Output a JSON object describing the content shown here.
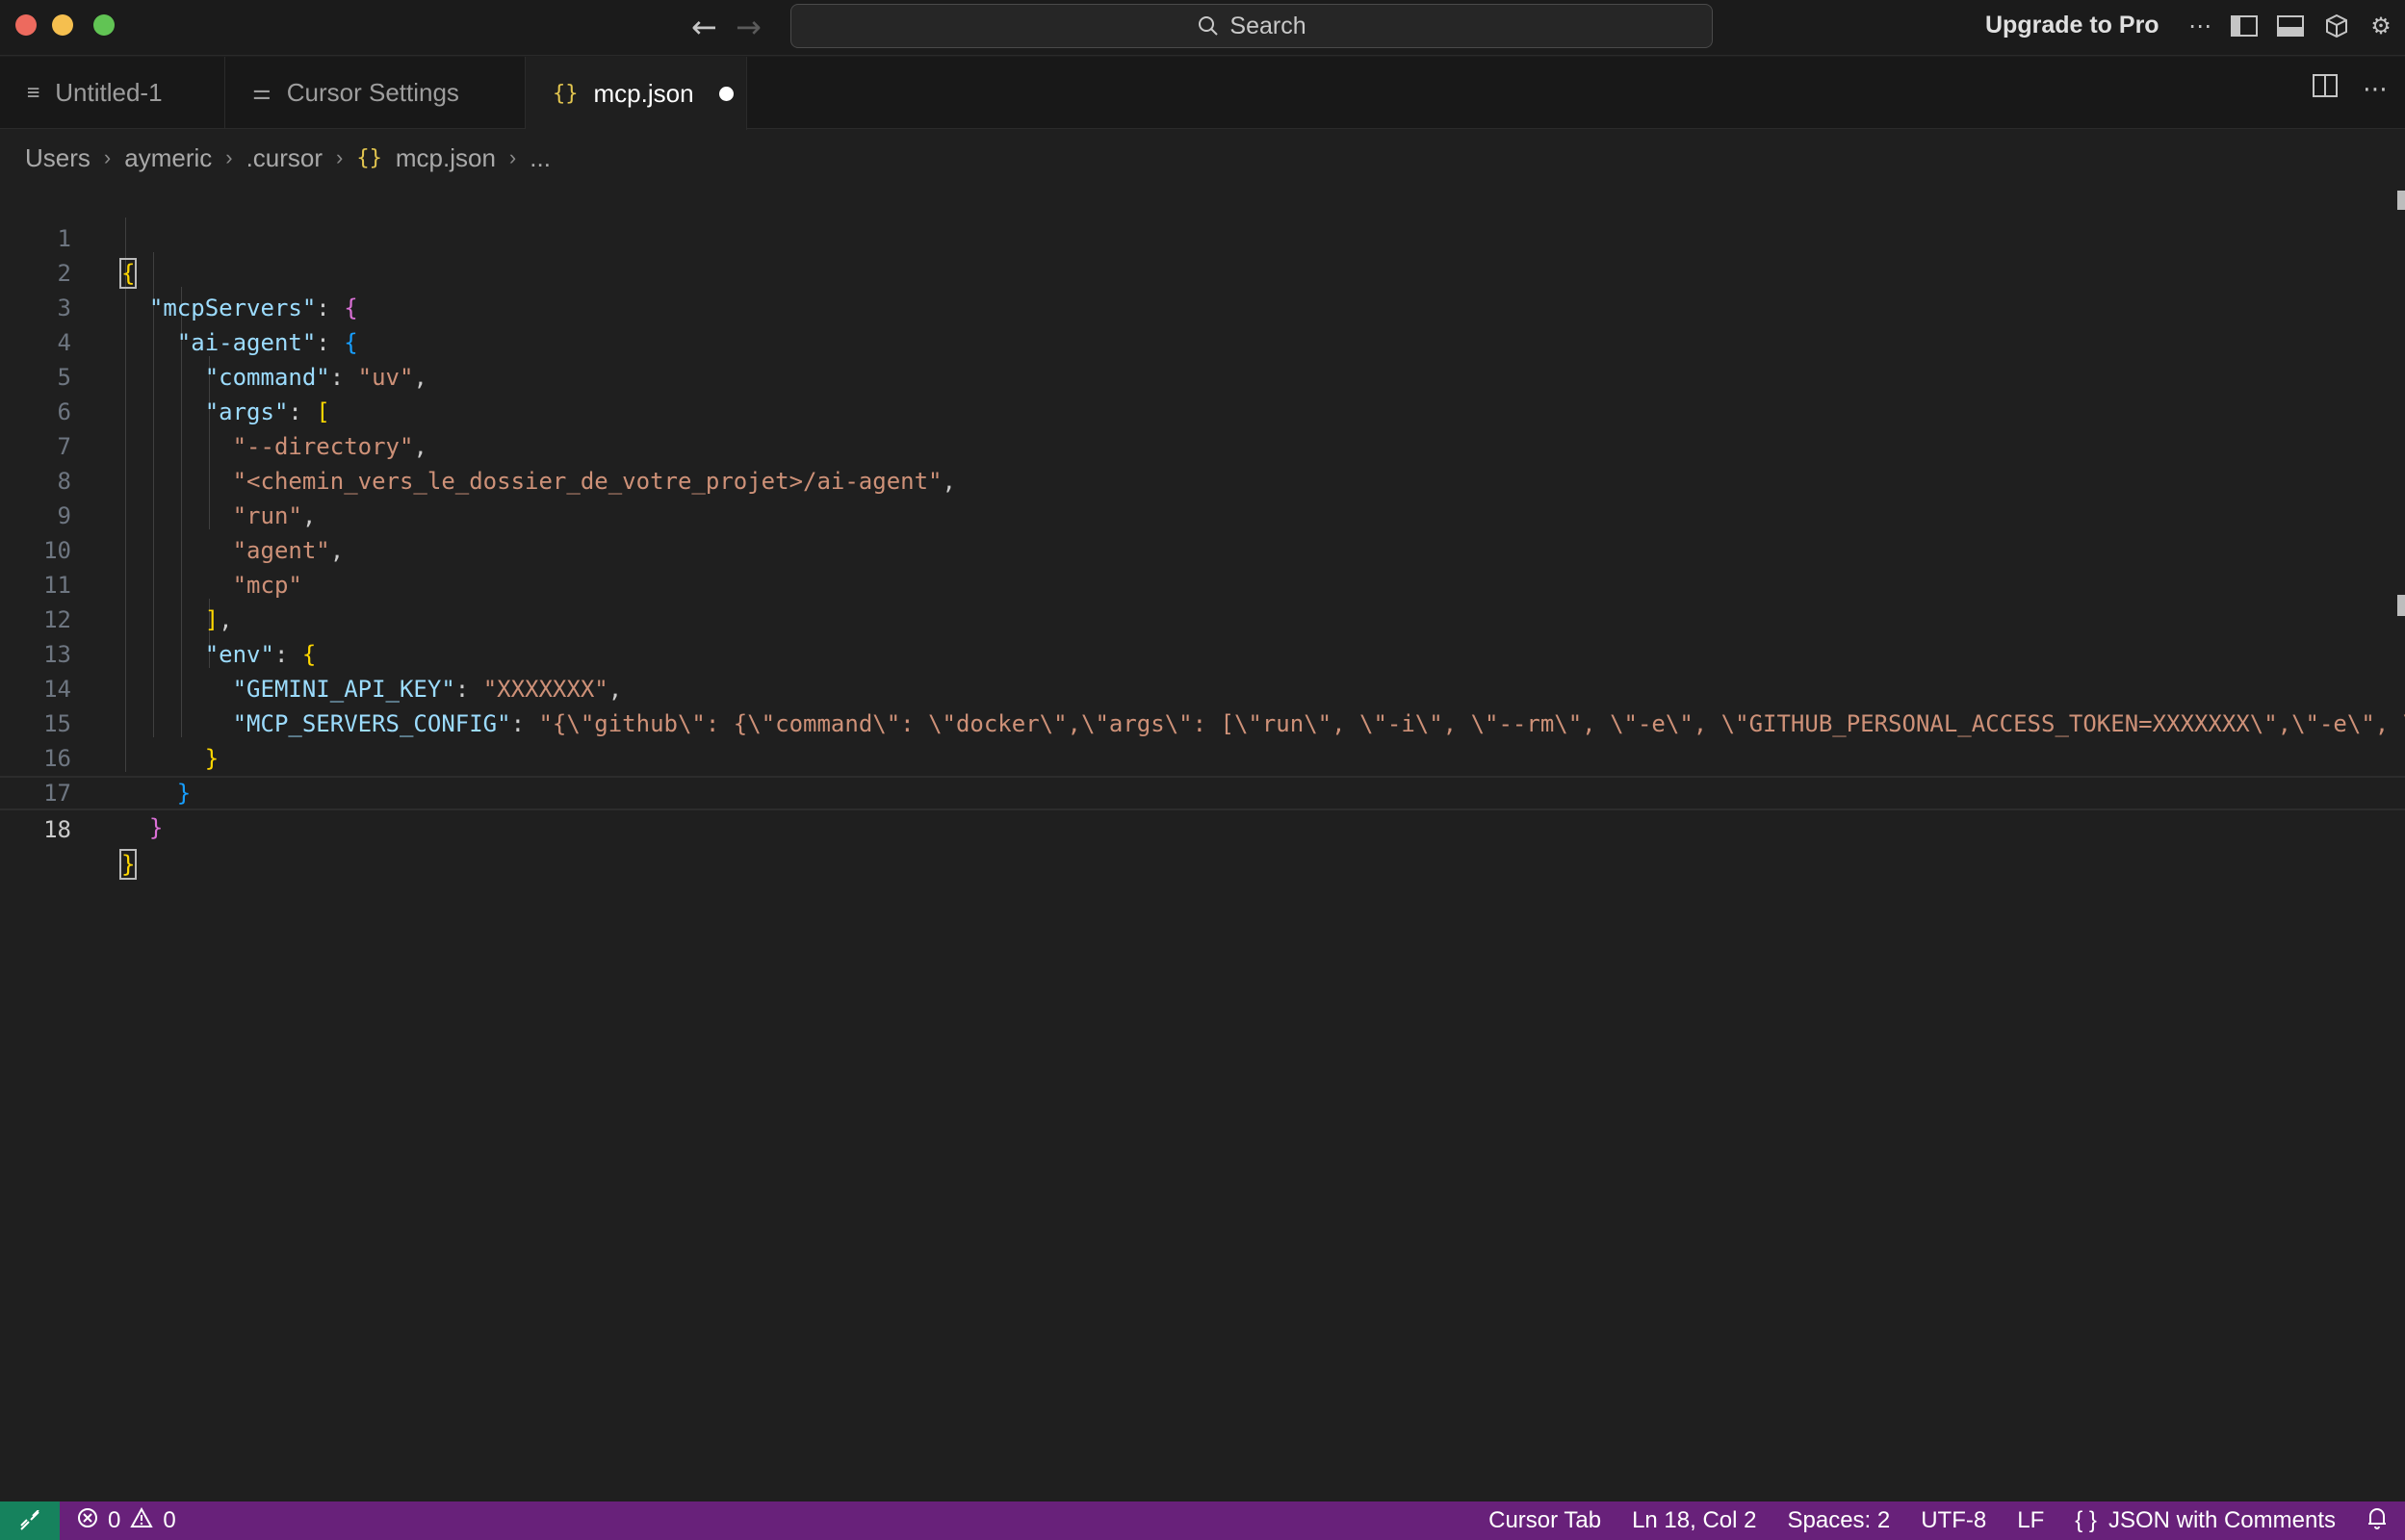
{
  "titlebar": {
    "search_placeholder": "Search",
    "upgrade_label": "Upgrade to Pro",
    "icons": [
      "back-arrow-icon",
      "forward-arrow-icon",
      "search-icon",
      "more-icon",
      "toggle-primary-sidebar-icon",
      "toggle-panel-icon",
      "cube-icon",
      "gear-icon"
    ]
  },
  "tabs": [
    {
      "label": "Untitled-1",
      "icon": "file-lines-icon",
      "active": false
    },
    {
      "label": "Cursor Settings",
      "icon": "settings-sliders-icon",
      "active": false
    },
    {
      "label": "mcp.json",
      "icon": "json-braces-icon",
      "active": true,
      "dirty": true
    }
  ],
  "breadcrumb": {
    "items": [
      "Users",
      "aymeric",
      ".cursor",
      "mcp.json",
      "..."
    ],
    "file_icon": "{}"
  },
  "editor": {
    "line_numbers": [
      "1",
      "2",
      "3",
      "4",
      "5",
      "6",
      "7",
      "8",
      "9",
      "10",
      "11",
      "12",
      "13",
      "14",
      "15",
      "16",
      "17",
      "18"
    ],
    "current_line": 18,
    "tokens": {
      "l2_key": "\"mcpServers\"",
      "l3_key": "\"ai-agent\"",
      "l4_key": "\"command\"",
      "l4_val": "\"uv\"",
      "l5_key": "\"args\"",
      "l6_val": "\"--directory\"",
      "l7_val": "\"<chemin_vers_le_dossier_de_votre_projet>/ai-agent\"",
      "l8_val": "\"run\"",
      "l9_val": "\"agent\"",
      "l10_val": "\"mcp\"",
      "l12_key": "\"env\"",
      "l13_key": "\"GEMINI_API_KEY\"",
      "l13_val": "\"XXXXXXX\"",
      "l14_key": "\"MCP_SERVERS_CONFIG\"",
      "l14_val": "\"{\\\"github\\\": {\\\"command\\\": \\\"docker\\\",\\\"args\\\": [\\\"run\\\", \\\"-i\\\", \\\"--rm\\\", \\\"-e\\\", \\\"GITHUB_PERSONAL_ACCESS_TOKEN=XXXXXXX\\\",\\\"-e\\\", \\\""
    }
  },
  "statusbar": {
    "remote_icon": "remote-icon",
    "errors": "0",
    "warnings": "0",
    "cursor_tab": "Cursor Tab",
    "position": "Ln 18, Col 2",
    "spaces": "Spaces: 2",
    "encoding": "UTF-8",
    "eol": "LF",
    "language_icon": "{ }",
    "language": "JSON with Comments",
    "bell_icon": "bell-icon"
  },
  "colors": {
    "key": "#9cdcfe",
    "string": "#ce9178",
    "bracket_level1": "#ffd700",
    "bracket_level2": "#da70d6",
    "bracket_level3": "#179fff",
    "statusbar": "#68217a"
  }
}
